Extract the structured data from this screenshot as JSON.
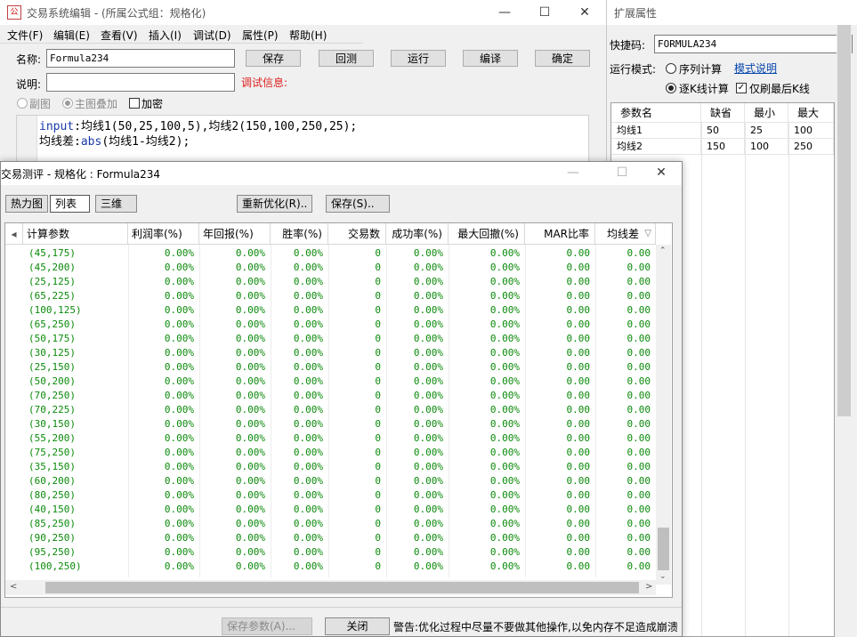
{
  "editor": {
    "title": "交易系统编辑 - (所属公式组：规格化)",
    "menu": [
      "文件(F)",
      "编辑(E)",
      "查看(V)",
      "插入(I)",
      "调试(D)",
      "属性(P)",
      "帮助(H)"
    ],
    "name_label": "名称:",
    "name_value": "Formula234",
    "desc_label": "说明:",
    "desc_value": "",
    "debug_label": "调试信息:",
    "buttons": [
      "保存",
      "回测",
      "运行",
      "编译",
      "确定"
    ],
    "sub_chart": "副图",
    "main_overlay": "主图叠加",
    "encrypt": "加密",
    "code": {
      "l1_kw": "input",
      "l1_rest": ":均线1(50,25,100,5),均线2(150,100,250,25);",
      "l2_a": "均线差:",
      "l2_kw": "abs",
      "l2_rest": "(均线1-均线2);"
    }
  },
  "props": {
    "title": "扩展属性",
    "shortcut_label": "快捷码:",
    "shortcut_value": "FORMULA234",
    "mode_label": "运行模式:",
    "mode_seq": "序列计算",
    "mode_help": "模式说明",
    "mode_kline": "逐K线计算",
    "refresh_last": "仅刷最后K线",
    "headers": [
      "参数名",
      "缺省",
      "最小",
      "最大"
    ],
    "rows": [
      [
        "均线1",
        "50",
        "25",
        "100"
      ],
      [
        "均线2",
        "150",
        "100",
        "250"
      ]
    ]
  },
  "dialog": {
    "title": "交易测评 - 规格化 : Formula234",
    "tabs": [
      "热力图",
      "列表",
      "三维"
    ],
    "reoptimize": "重新优化(R)..",
    "save": "保存(S)..",
    "save_params": "保存参数(A)...",
    "close": "关闭",
    "warning": "警告:优化过程中尽量不要做其他操作,以免内存不足造成崩溃",
    "columns": [
      "计算参数",
      "利润率(%)",
      "年回报(%)",
      "胜率(%)",
      "交易数",
      "成功率(%)",
      "最大回撤(%)",
      "MAR比率",
      "均线差"
    ],
    "params": [
      "(45,175)",
      "(45,200)",
      "(25,125)",
      "(65,225)",
      "(100,125)",
      "(65,250)",
      "(50,175)",
      "(30,125)",
      "(25,150)",
      "(50,200)",
      "(70,250)",
      "(70,225)",
      "(30,150)",
      "(55,200)",
      "(75,250)",
      "(35,150)",
      "(60,200)",
      "(80,250)",
      "(40,150)",
      "(85,250)",
      "(90,250)",
      "(95,250)",
      "(100,250)"
    ],
    "row_values": [
      "0.00%",
      "0.00%",
      "0.00%",
      "0",
      "0.00%",
      "0.00%",
      "0.00",
      "0.00"
    ]
  }
}
